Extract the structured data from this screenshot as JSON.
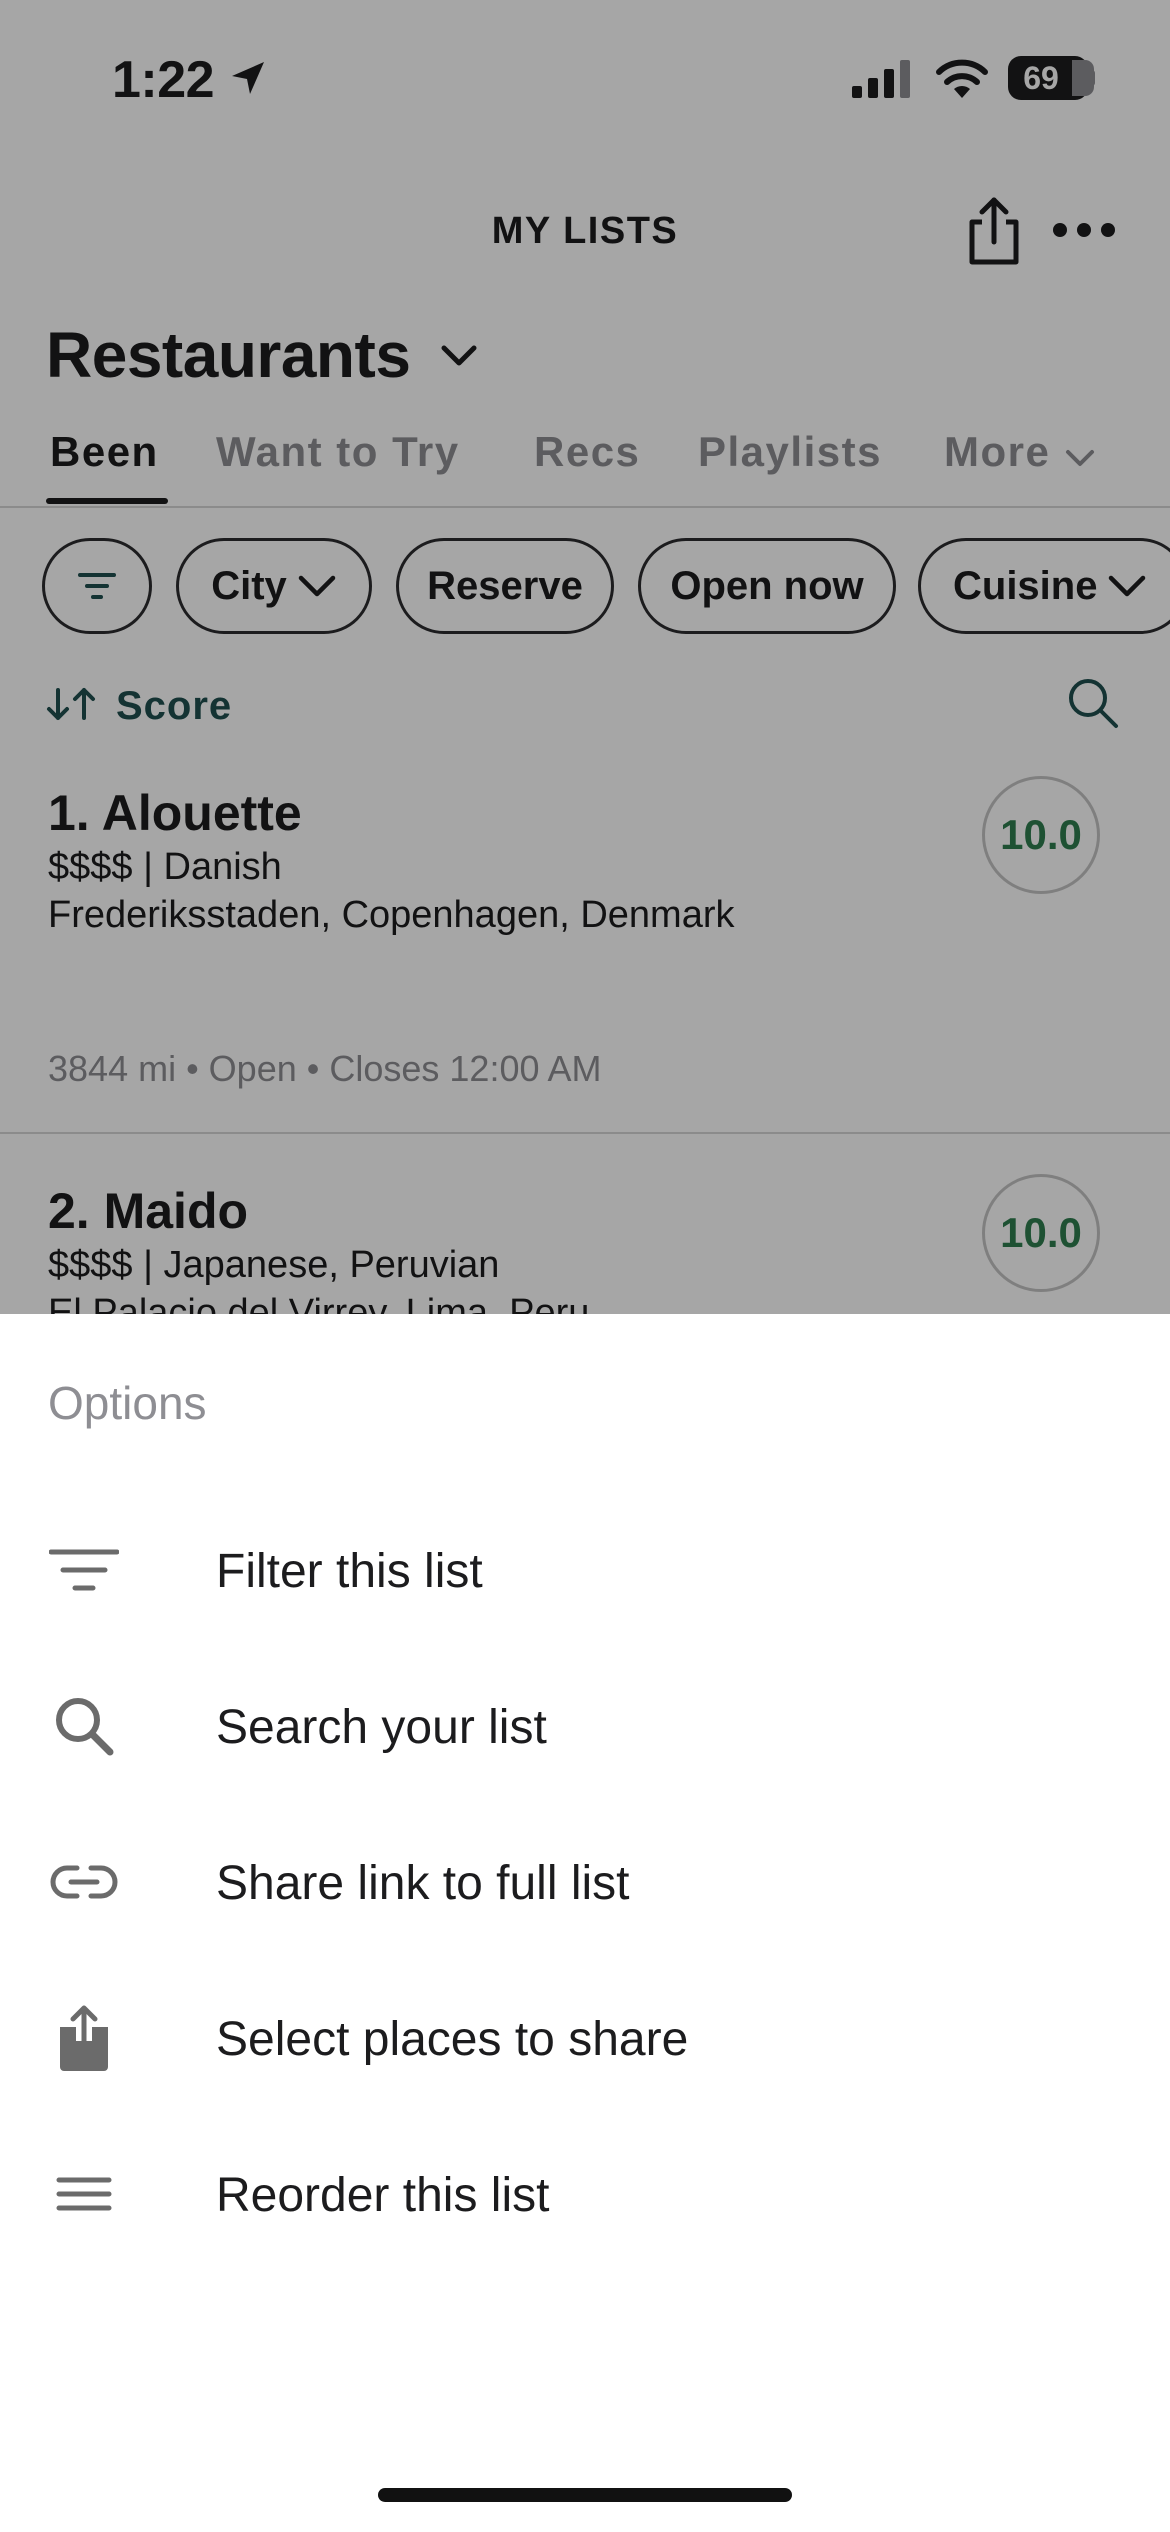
{
  "status_bar": {
    "time": "1:22",
    "battery": "69"
  },
  "header": {
    "title": "MY LISTS",
    "list_title": "Restaurants"
  },
  "tabs": [
    {
      "label": "Been",
      "active": true
    },
    {
      "label": "Want to Try",
      "active": false
    },
    {
      "label": "Recs",
      "active": false
    },
    {
      "label": "Playlists",
      "active": false
    },
    {
      "label": "More",
      "active": false
    }
  ],
  "filters": {
    "city": "City",
    "reserve": "Reserve",
    "open_now": "Open now",
    "cuisine": "Cuisine"
  },
  "sort": {
    "label": "Score"
  },
  "places": [
    {
      "name": "1. Alouette",
      "meta": "$$$$ | Danish",
      "location": "Frederiksstaden, Copenhagen, Denmark",
      "footer": "3844 mi • Open • Closes 12:00 AM",
      "score": "10.0"
    },
    {
      "name": "2. Maido",
      "meta": "$$$$ | Japanese, Peruvian",
      "location": "El Palacio del Virrey, Lima, Peru",
      "score": "10.0"
    }
  ],
  "options_sheet": {
    "header": "Options",
    "items": [
      {
        "label": "Filter this list",
        "icon": "filter-icon"
      },
      {
        "label": "Search your list",
        "icon": "search-icon"
      },
      {
        "label": "Share link to full list",
        "icon": "link-icon"
      },
      {
        "label": "Select places to share",
        "icon": "share-icon"
      },
      {
        "label": "Reorder this list",
        "icon": "reorder-icon"
      }
    ]
  },
  "colors": {
    "accent": "#1f4f4f",
    "score": "#2e7d4f",
    "overlay": "rgba(0,0,0,0.35)"
  }
}
